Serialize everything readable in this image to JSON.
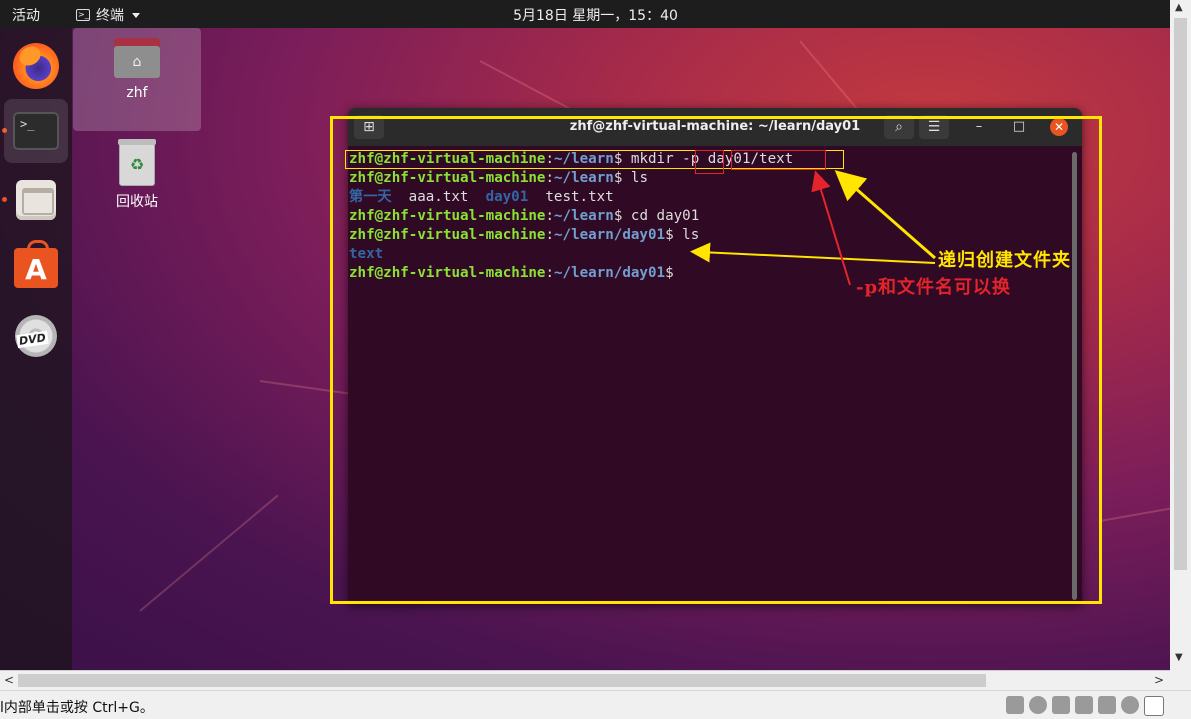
{
  "topbar": {
    "activities": "活动",
    "app_name": "终端",
    "clock": "5月18日 星期一，15：40"
  },
  "dock": {
    "items": [
      "firefox-icon",
      "terminal-icon",
      "files-icon",
      "software-icon",
      "dvd-icon"
    ],
    "terminal_glyph": ">_",
    "dvd_label": "DVD"
  },
  "desktop": {
    "home_folder": "zhf",
    "trash": "回收站"
  },
  "terminal": {
    "title": "zhf@zhf-virtual-machine: ~/learn/day01",
    "user_host": "zhf@zhf-virtual-machine",
    "lines": [
      {
        "path": "~/learn",
        "cmd": " mkdir -p day01/text"
      },
      {
        "path": "~/learn",
        "cmd": " ls"
      },
      {
        "ls": [
          "第一天",
          "aaa.txt",
          "day01",
          "test.txt"
        ]
      },
      {
        "path": "~/learn",
        "cmd": " cd day01"
      },
      {
        "path": "~/learn/day01",
        "cmd": " ls"
      },
      {
        "ls": [
          "text"
        ]
      },
      {
        "path": "~/learn/day01",
        "cmd": ""
      }
    ]
  },
  "annotations": {
    "recursive": "递归创建文件夹",
    "swap": "-p和文件名可以换",
    "yellow_color": "#ffe500",
    "red_color": "#e3242b"
  },
  "status": {
    "message": "l内部单击或按 Ctrl+G。"
  }
}
